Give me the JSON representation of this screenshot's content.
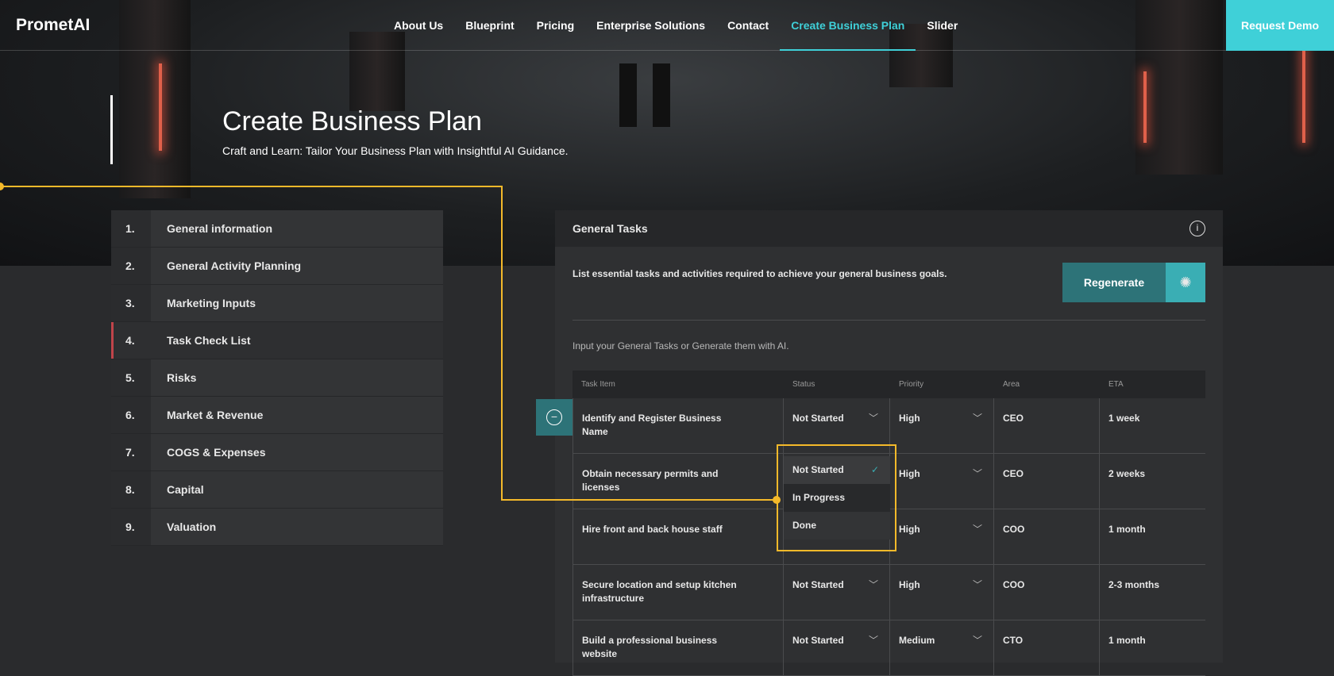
{
  "brand": "PrometAI",
  "nav": {
    "items": [
      "About Us",
      "Blueprint",
      "Pricing",
      "Enterprise Solutions",
      "Contact",
      "Create Business Plan",
      "Slider"
    ],
    "active": "Create Business Plan",
    "cta": "Request Demo"
  },
  "hero": {
    "title": "Create Business Plan",
    "subtitle": "Craft and Learn: Tailor Your Business Plan with Insightful AI Guidance."
  },
  "sidebar": {
    "items": [
      {
        "num": "1.",
        "label": "General information"
      },
      {
        "num": "2.",
        "label": "General Activity Planning"
      },
      {
        "num": "3.",
        "label": "Marketing Inputs"
      },
      {
        "num": "4.",
        "label": "Task Check List"
      },
      {
        "num": "5.",
        "label": "Risks"
      },
      {
        "num": "6.",
        "label": "Market & Revenue"
      },
      {
        "num": "7.",
        "label": "COGS & Expenses"
      },
      {
        "num": "8.",
        "label": "Capital"
      },
      {
        "num": "9.",
        "label": "Valuation"
      }
    ],
    "active": "Task Check List"
  },
  "panel": {
    "title": "General Tasks",
    "description": "List essential tasks and activities required to achieve your general business goals.",
    "regenerate": "Regenerate",
    "helper": "Input your General Tasks or Generate them with AI.",
    "columns": [
      "Task Item",
      "Status",
      "Priority",
      "Area",
      "ETA"
    ],
    "rows": [
      {
        "task": "Identify and Register Business Name",
        "status": "Not Started",
        "priority": "High",
        "area": "CEO",
        "eta": "1 week"
      },
      {
        "task": "Obtain necessary permits and licenses",
        "status": "Not Started",
        "priority": "High",
        "area": "CEO",
        "eta": "2 weeks"
      },
      {
        "task": "Hire front and back house staff",
        "status": "Not Started",
        "priority": "High",
        "area": "COO",
        "eta": "1 month"
      },
      {
        "task": "Secure location and setup kitchen infrastructure",
        "status": "Not Started",
        "priority": "High",
        "area": "COO",
        "eta": "2-3 months"
      },
      {
        "task": "Build a professional business website",
        "status": "Not Started",
        "priority": "Medium",
        "area": "CTO",
        "eta": "1 month"
      }
    ],
    "status_options": [
      "Not Started",
      "In Progress",
      "Done"
    ],
    "status_selected": "Not Started"
  },
  "colors": {
    "accent": "#3fd0d8",
    "teal": "#2d7378",
    "highlight": "#f4b92a",
    "active_marker": "#c0444a"
  }
}
